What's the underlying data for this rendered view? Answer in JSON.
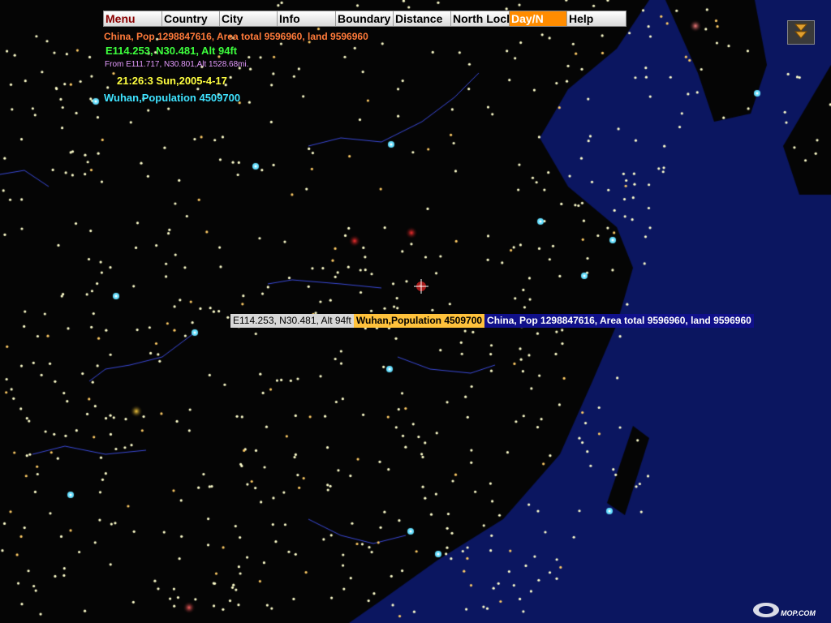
{
  "menu": {
    "items": [
      {
        "label": "Menu"
      },
      {
        "label": "Country"
      },
      {
        "label": "City"
      },
      {
        "label": "Info"
      },
      {
        "label": "Boundary"
      },
      {
        "label": "Distance"
      },
      {
        "label": "North Lock"
      },
      {
        "label": "Day/N"
      },
      {
        "label": "Help"
      }
    ],
    "active_label": "Day/N"
  },
  "info": {
    "country": "China, Pop  1298847616, Area total 9596960, land 9596960",
    "coords": "E114.253, N30.481, Alt 94ft",
    "from": "From E111.717, N30.801,Alt 1528.68mi.",
    "datetime": "21:26:3 Sun,2005-4-17",
    "city": "Wuhan,Population  4509700"
  },
  "tooltip": {
    "coords": "E114.253, N30.481, Alt 94ft",
    "city": "Wuhan,Population  4509700",
    "country": "China, Pop  1298847616, Area total 9596960, land 9596960"
  },
  "watermark": "MOP.COM",
  "icons": {
    "collapse": "double-chevron-down-icon",
    "cursor": "crosshair-icon",
    "logo": "mop-logo-icon"
  },
  "colors": {
    "ocean": "#0b1660",
    "land": "#050505",
    "river": "#3a49d8",
    "city_dot": "#ffffcc",
    "big_city": "#66e0ff"
  }
}
